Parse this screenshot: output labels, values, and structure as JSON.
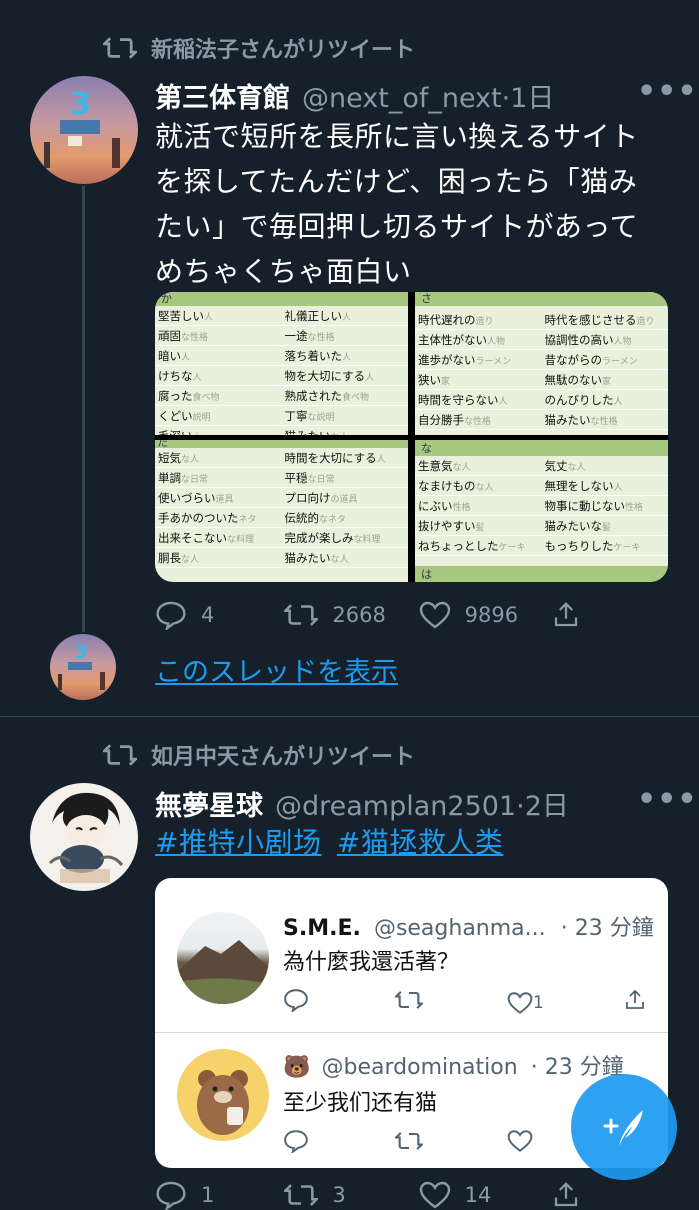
{
  "tweet1": {
    "retweeted_by": "新稲法子さんがリツイート",
    "name": "第三体育館",
    "handle": "@next_of_next",
    "time": "·1日",
    "text_lines": [
      "就活で短所を長所に言い換えるサイト",
      "を探してたんだけど、困ったら「猫み",
      "たい」で毎回押し切るサイトがあって",
      "めちゃくちゃ面白い"
    ],
    "reply_count": "4",
    "retweet_count": "2668",
    "like_count": "9896",
    "show_thread": "このスレッドを表示",
    "images": {
      "ka": {
        "header": "か",
        "rows": [
          [
            "堅苦しい",
            "人",
            "礼儀正しい",
            "人"
          ],
          [
            "頑固",
            "な性格",
            "一途",
            "な性格"
          ],
          [
            "暗い",
            "人",
            "落ち着いた",
            "人"
          ],
          [
            "けちな",
            "人",
            "物を大切にする",
            "人"
          ],
          [
            "腐った",
            "食べ物",
            "熟成された",
            "食べ物"
          ],
          [
            "くどい",
            "説明",
            "丁寧",
            "な説明"
          ],
          [
            "毛深い",
            "人",
            "猫みたい",
            "な人"
          ]
        ]
      },
      "sa": {
        "header": "さ",
        "rows": [
          [
            "時代遅れの",
            "造り",
            "時代を感じさせる",
            "造り"
          ],
          [
            "主体性がない",
            "人物",
            "協調性の高い",
            "人物"
          ],
          [
            "進歩がない",
            "ラーメン",
            "昔ながらの",
            "ラーメン"
          ],
          [
            "狭い",
            "家",
            "無駄のない",
            "家"
          ],
          [
            "時間を守らない",
            "人",
            "のんびりした",
            "人"
          ],
          [
            "自分勝手",
            "な性格",
            "猫みたい",
            "な性格"
          ]
        ]
      },
      "ta": {
        "header": "た",
        "rows": [
          [
            "短気",
            "な人",
            "時間を大切にする",
            "人"
          ],
          [
            "単調",
            "な日常",
            "平穏",
            "な日常"
          ],
          [
            "使いづらい",
            "道具",
            "プロ向け",
            "の道具"
          ],
          [
            "手あかのついた",
            "ネタ",
            "伝統的",
            "なネタ"
          ],
          [
            "出来そこない",
            "な料理",
            "完成が楽しみ",
            "な料理"
          ],
          [
            "胴長",
            "な人",
            "猫みたい",
            "な人"
          ]
        ]
      },
      "na": {
        "header": "な",
        "footer": "は",
        "rows": [
          [
            "生意気",
            "な人",
            "気丈",
            "な人"
          ],
          [
            "なまけもの",
            "な人",
            "無理をしない",
            "人"
          ],
          [
            "にぶい",
            "性格",
            "物事に動じない",
            "性格"
          ],
          [
            "抜けやすい",
            "髪",
            "猫みたいな",
            "髪"
          ],
          [
            "ねちょっとした",
            "ケーキ",
            "もっちりした",
            "ケーキ"
          ]
        ]
      }
    }
  },
  "tweet2": {
    "retweeted_by": "如月中天さんがリツイート",
    "name": "無夢星球",
    "handle": "@dreamplan2501",
    "time": "·2日",
    "hashtag1": "#推特小剧场",
    "hashtag2": "#猫拯救人类",
    "quote1": {
      "name": "S.M.E.",
      "handle": "@seaghanma...",
      "time": "· 23 分鐘",
      "text": "為什麼我還活著？",
      "like_count": "1"
    },
    "quote2": {
      "emoji": "🐻",
      "handle": "@beardomination",
      "time": "· 23 分鐘",
      "text": "至少我们还有猫"
    },
    "reply_count": "1",
    "retweet_count": "3",
    "like_count": "14"
  },
  "more_label": "•••",
  "colors": {
    "background": "#15202b",
    "accent": "#1d9bf0",
    "muted": "#8b98a5"
  }
}
